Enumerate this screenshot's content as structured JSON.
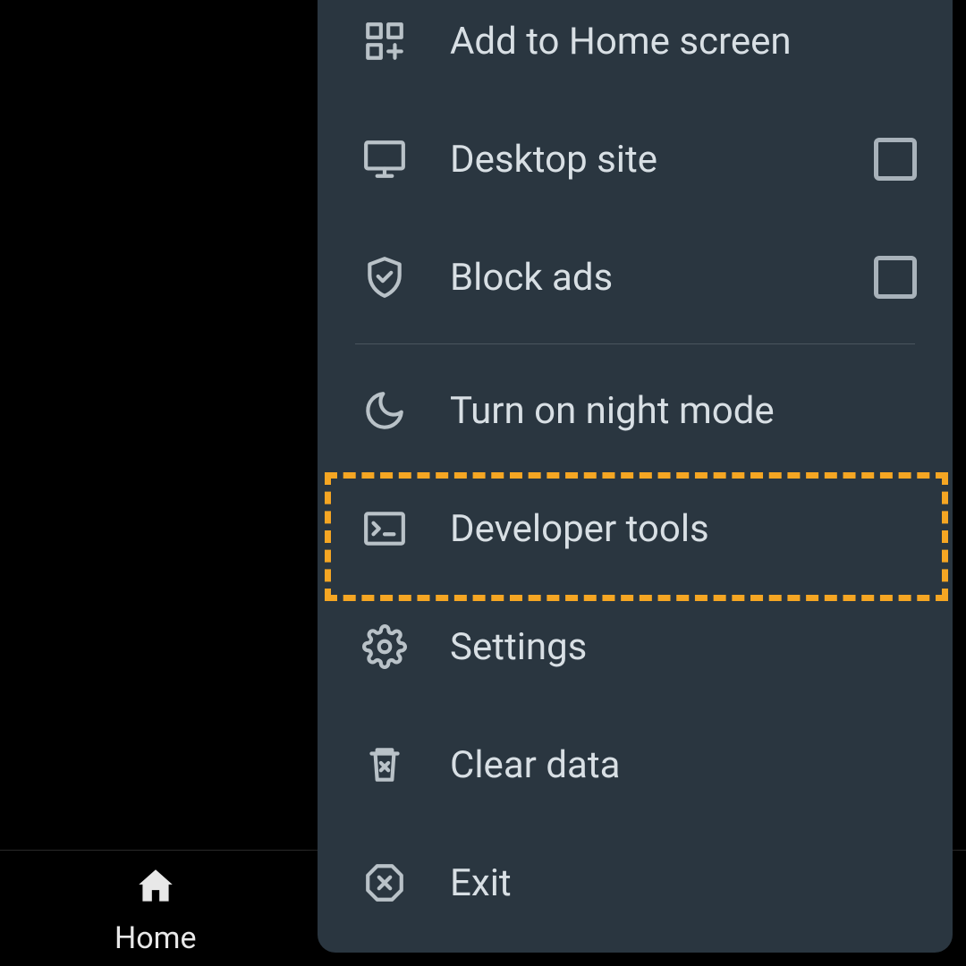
{
  "bottom_nav": {
    "home_label": "Home"
  },
  "menu": {
    "items": [
      {
        "label": "Add to Home screen",
        "icon": "add-home-icon",
        "has_checkbox": false
      },
      {
        "label": "Desktop site",
        "icon": "monitor-icon",
        "has_checkbox": true
      },
      {
        "label": "Block ads",
        "icon": "shield-check-icon",
        "has_checkbox": true
      },
      {
        "label": "Turn on night mode",
        "icon": "moon-icon",
        "has_checkbox": false
      },
      {
        "label": "Developer tools",
        "icon": "terminal-icon",
        "has_checkbox": false
      },
      {
        "label": "Settings",
        "icon": "gear-icon",
        "has_checkbox": false
      },
      {
        "label": "Clear data",
        "icon": "trash-icon",
        "has_checkbox": false
      },
      {
        "label": "Exit",
        "icon": "exit-icon",
        "has_checkbox": false
      }
    ]
  }
}
